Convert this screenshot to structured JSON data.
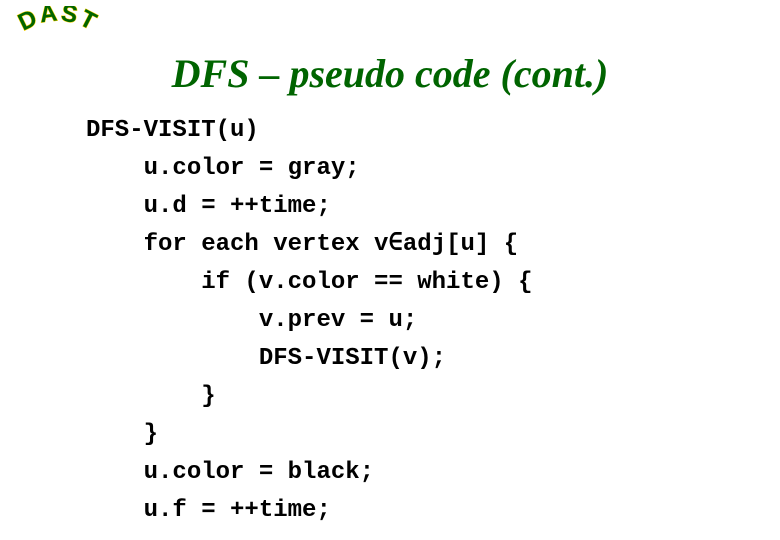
{
  "logo_text": "DAST",
  "title": "DFS – pseudo code (cont.)",
  "code_lines": [
    "DFS-VISIT(u)",
    "    u.color = gray;",
    "    u.d = ++time;",
    "    for each vertex v∈adj[u] {",
    "        if (v.color == white) {",
    "            v.prev = u;",
    "            DFS-VISIT(v);",
    "        }",
    "    }",
    "    u.color = black;",
    "    u.f = ++time;"
  ]
}
